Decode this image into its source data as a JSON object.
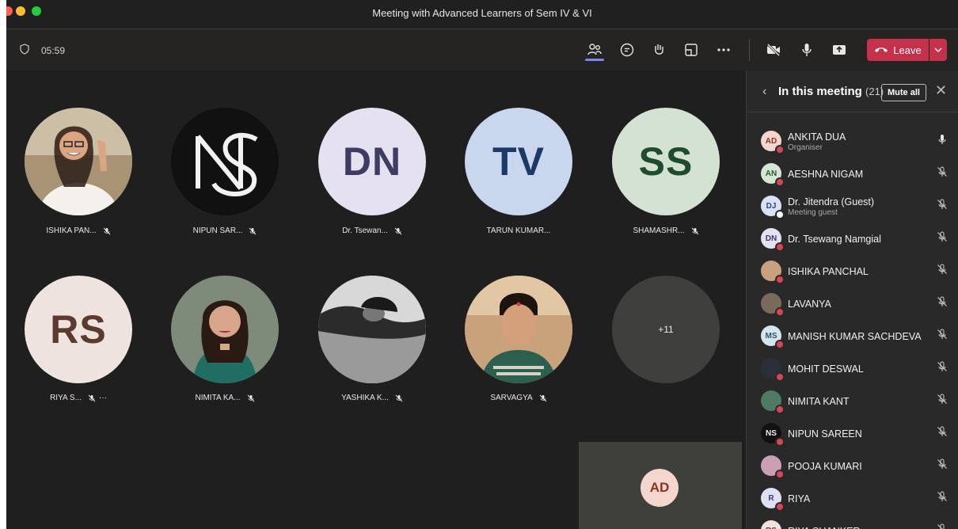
{
  "window": {
    "title": "Meeting with Advanced Learners of Sem IV & VI"
  },
  "toolbar": {
    "timer": "05:59",
    "icons": [
      "shield-icon",
      "people-icon",
      "chat-icon",
      "raise-hand-icon",
      "rooms-icon",
      "more-icon",
      "camera-off-icon",
      "mic-icon",
      "share-icon"
    ],
    "leave_label": "Leave"
  },
  "grid": {
    "tiles": [
      {
        "name": "ISHIKA PAN...",
        "type": "photo",
        "muted": true
      },
      {
        "name": "NIPUN SAR...",
        "type": "logo",
        "muted": true
      },
      {
        "name": "Dr. Tsewan...",
        "initials": "DN",
        "bg": "#e5e1f1",
        "fg": "#3d3c62",
        "muted": true
      },
      {
        "name": "TARUN KUMAR...",
        "initials": "TV",
        "bg": "#c8d6ee",
        "fg": "#1b3a66",
        "muted": false
      },
      {
        "name": "SHAMASHR...",
        "initials": "SS",
        "bg": "#d3e2d3",
        "fg": "#1f4d2b",
        "muted": true
      },
      {
        "name": "RIYA S...",
        "initials": "RS",
        "bg": "#efe3df",
        "fg": "#5c3a2e",
        "muted": true,
        "more": "···"
      },
      {
        "name": "NIMITA KA...",
        "type": "photo",
        "muted": true
      },
      {
        "name": "YASHIKA K...",
        "type": "photo",
        "muted": true
      },
      {
        "name": "SARVAGYA",
        "type": "photo",
        "muted": true
      },
      {
        "name": "",
        "overflow": "+11"
      }
    ],
    "self_view": {
      "initials": "AD"
    }
  },
  "panel": {
    "title": "In this meeting",
    "count": "(21)",
    "mute_all": "Mute all",
    "participants": [
      {
        "initials": "AD",
        "name": "ANKITA DUA",
        "role": "Organiser",
        "bg": "#f5d6cf",
        "fg": "#8a3322",
        "mic": "on"
      },
      {
        "initials": "AN",
        "name": "AESHNA NIGAM",
        "role": "",
        "bg": "#d4e6d4",
        "fg": "#2d5a2d",
        "mic": "off"
      },
      {
        "initials": "DJ",
        "name": "Dr. Jitendra (Guest)",
        "role": "Meeting guest",
        "bg": "#d9e2f5",
        "fg": "#2e4a7d",
        "mic": "off"
      },
      {
        "initials": "DN",
        "name": "Dr. Tsewang Namgial",
        "role": "",
        "bg": "#e5e1f1",
        "fg": "#3d3c62",
        "mic": "off"
      },
      {
        "initials": "",
        "name": "ISHIKA PANCHAL",
        "role": "",
        "bg": "#c9a07d",
        "fg": "#fff",
        "mic": "off"
      },
      {
        "initials": "",
        "name": "LAVANYA",
        "role": "",
        "bg": "#7a6a5c",
        "fg": "#fff",
        "mic": "off"
      },
      {
        "initials": "MS",
        "name": "MANISH KUMAR SACHDEVA",
        "role": "",
        "bg": "#d5e5ec",
        "fg": "#2e5566",
        "mic": "off"
      },
      {
        "initials": "",
        "name": "MOHIT DESWAL",
        "role": "",
        "bg": "#2a2f3a",
        "fg": "#fff",
        "mic": "off"
      },
      {
        "initials": "",
        "name": "NIMITA KANT",
        "role": "",
        "bg": "#4f7a63",
        "fg": "#fff",
        "mic": "off"
      },
      {
        "initials": "NS",
        "name": "NIPUN SAREEN",
        "role": "",
        "bg": "#111",
        "fg": "#eee",
        "mic": "off"
      },
      {
        "initials": "",
        "name": "POOJA KUMARI",
        "role": "",
        "bg": "#c9a0b4",
        "fg": "#fff",
        "mic": "off"
      },
      {
        "initials": "R",
        "name": "RIYA",
        "role": "",
        "bg": "#dfe0f3",
        "fg": "#3b3d7a",
        "mic": "off"
      },
      {
        "initials": "RS",
        "name": "RIYA SHANKER",
        "role": "",
        "bg": "#efe3df",
        "fg": "#5c3a2e",
        "mic": "off"
      }
    ]
  },
  "colors": {
    "accent": "#7f85f5",
    "leave": "#c4314b",
    "status_busy": "#d74654"
  }
}
